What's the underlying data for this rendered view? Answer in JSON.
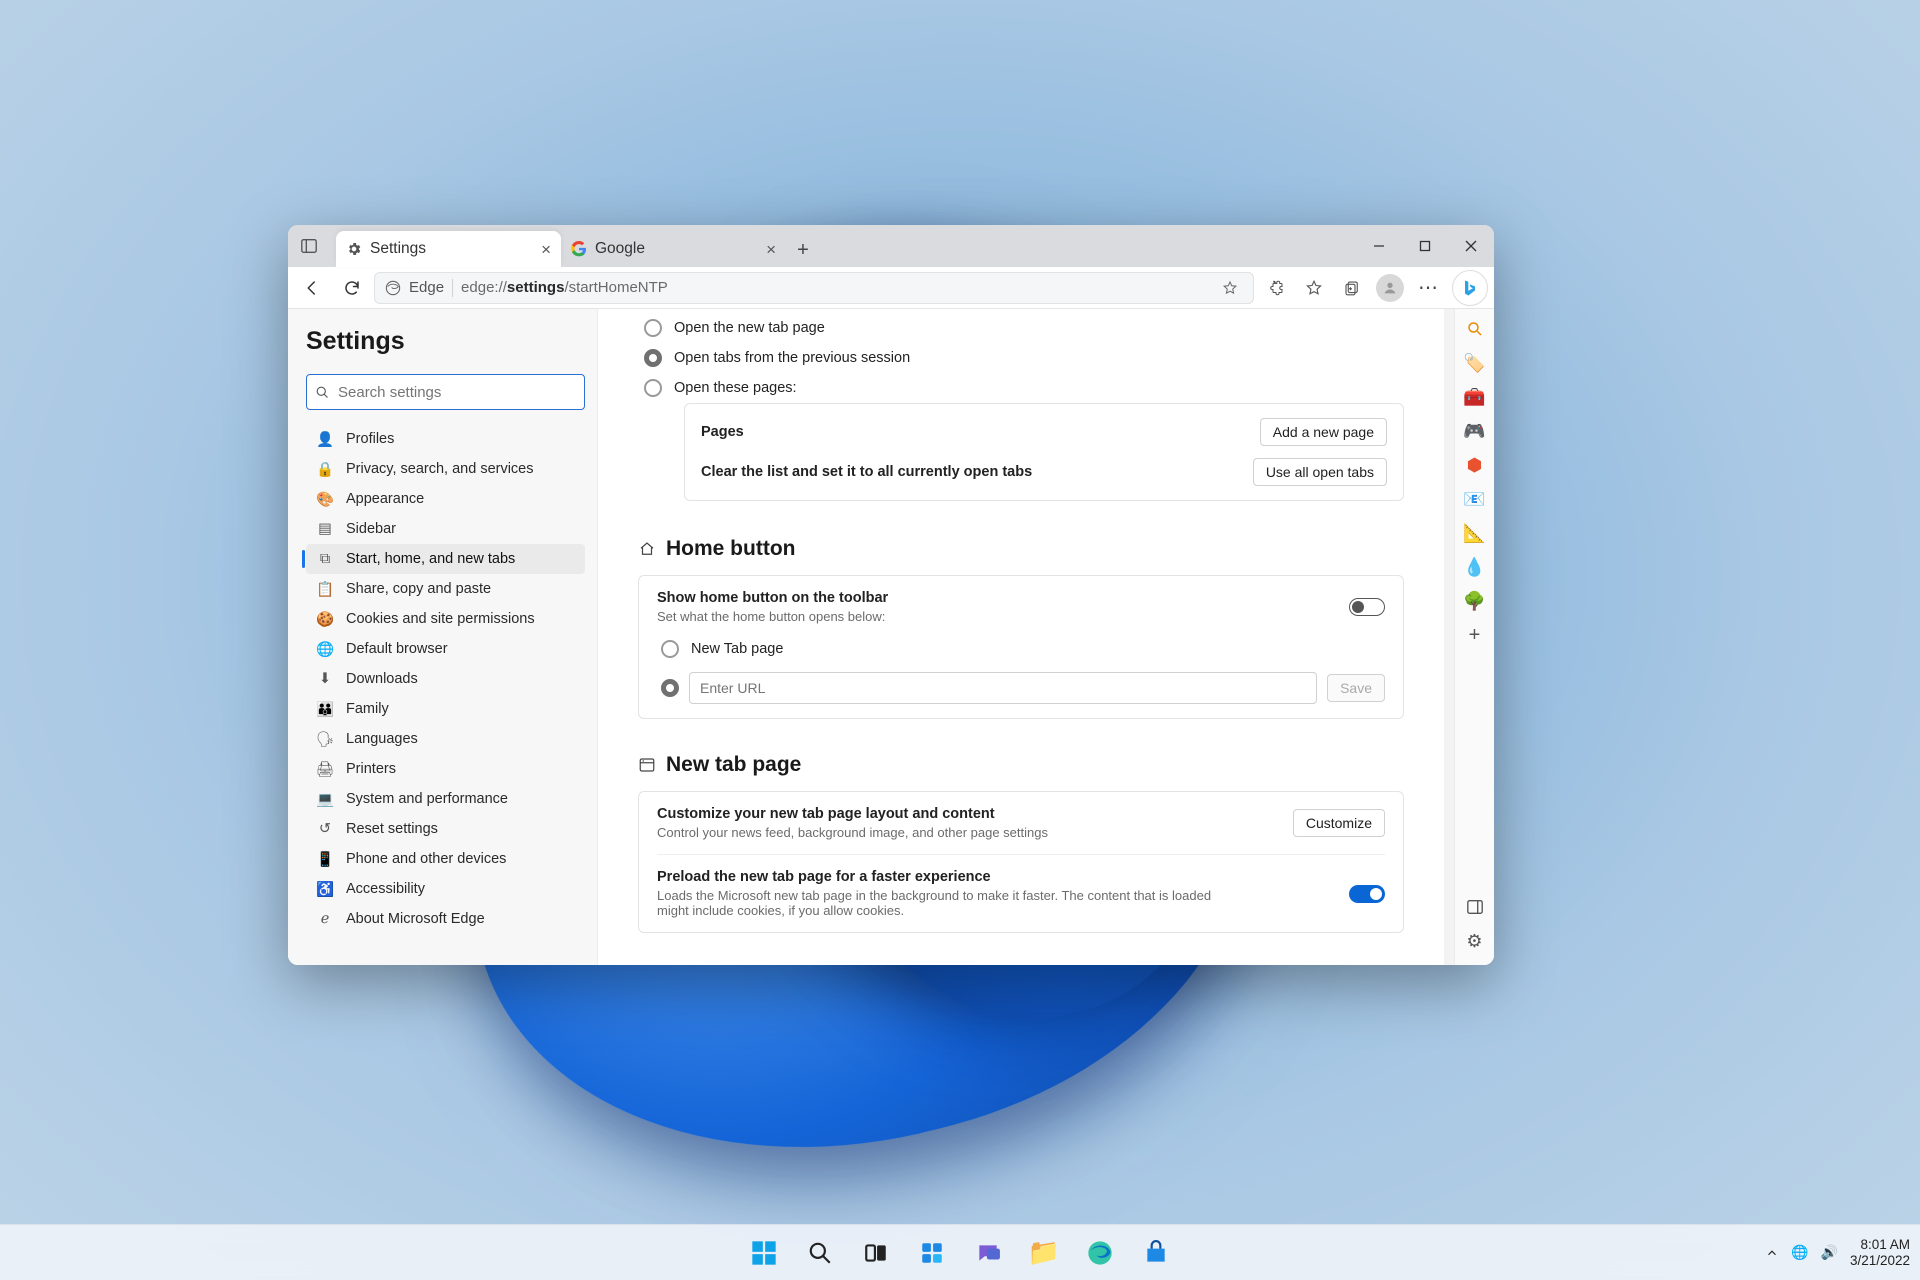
{
  "tabs": [
    {
      "label": "Settings",
      "active": true
    },
    {
      "label": "Google",
      "active": false
    }
  ],
  "addressbar": {
    "brand": "Edge",
    "url_prefix": "edge://",
    "url_bold": "settings",
    "url_suffix": "/startHomeNTP"
  },
  "settings": {
    "title": "Settings",
    "search_placeholder": "Search settings",
    "nav": [
      "Profiles",
      "Privacy, search, and services",
      "Appearance",
      "Sidebar",
      "Start, home, and new tabs",
      "Share, copy and paste",
      "Cookies and site permissions",
      "Default browser",
      "Downloads",
      "Family",
      "Languages",
      "Printers",
      "System and performance",
      "Reset settings",
      "Phone and other devices",
      "Accessibility",
      "About Microsoft Edge"
    ],
    "nav_active_index": 4
  },
  "startup": {
    "radio_open_new_tab": "Open the new tab page",
    "radio_open_prev": "Open tabs from the previous session",
    "radio_open_these": "Open these pages:",
    "pages_heading": "Pages",
    "add_btn": "Add a new page",
    "clear_label": "Clear the list and set it to all currently open tabs",
    "use_all_btn": "Use all open tabs"
  },
  "home_button": {
    "heading": "Home button",
    "show_label": "Show home button on the toolbar",
    "show_sub": "Set what the home button opens below:",
    "radio_newtab": "New Tab page",
    "url_placeholder": "Enter URL",
    "save_btn": "Save"
  },
  "newtab": {
    "heading": "New tab page",
    "customize_title": "Customize your new tab page layout and content",
    "customize_sub": "Control your news feed, background image, and other page settings",
    "customize_btn": "Customize",
    "preload_title": "Preload the new tab page for a faster experience",
    "preload_sub": "Loads the Microsoft new tab page in the background to make it faster. The content that is loaded might include cookies, if you allow cookies."
  },
  "systray": {
    "time": "8:01 AM",
    "date": "3/21/2022"
  }
}
